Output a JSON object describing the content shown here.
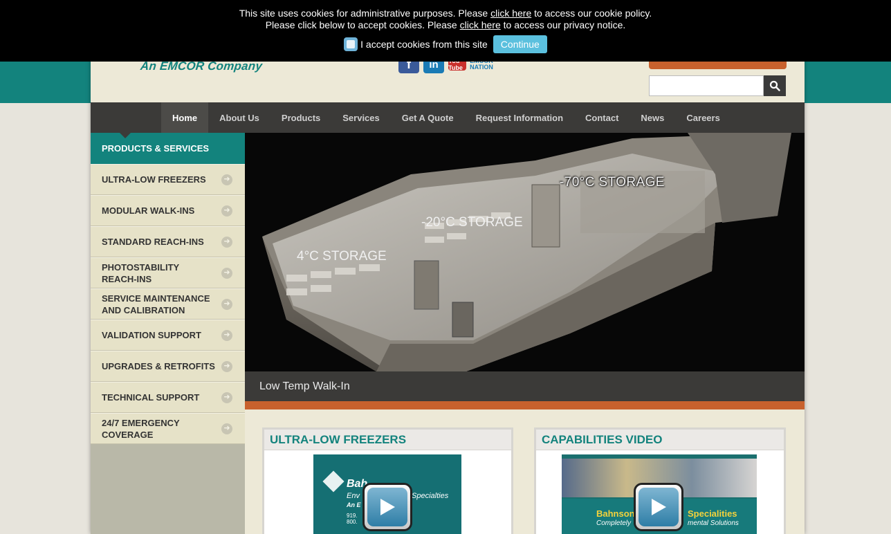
{
  "cookie": {
    "line1_prefix": "This site uses cookies for administrative purposes. Please ",
    "line1_link": "click here",
    "line1_suffix": " to access our cookie policy.",
    "line2_prefix": "Please click below to accept cookies. Please ",
    "line2_link": "click here",
    "line2_suffix": " to access our privacy notice.",
    "accept_label": "I accept cookies from this site",
    "continue_label": "Continue"
  },
  "header": {
    "tagline": "An EMCOR Company",
    "social": [
      "facebook-icon",
      "linkedin-icon",
      "youtube-icon",
      "emcor-nation-icon"
    ],
    "social_text": {
      "fb": "f",
      "li": "in",
      "yt": "You Tube",
      "ot1": "EMCOR",
      "ot2": "NATION"
    },
    "search_placeholder": ""
  },
  "nav": {
    "items": [
      "Home",
      "About Us",
      "Products",
      "Services",
      "Get A Quote",
      "Request Information",
      "Contact",
      "News",
      "Careers"
    ],
    "active": "Home"
  },
  "sidebar": {
    "heading": "PRODUCTS & SERVICES",
    "items": [
      "ULTRA-LOW FREEZERS",
      "MODULAR WALK-INS",
      "STANDARD REACH-INS",
      "PHOTOSTABILITY REACH-INS",
      "SERVICE MAINTENANCE AND CALIBRATION",
      "VALIDATION SUPPORT",
      "UPGRADES & RETROFITS",
      "TECHNICAL SUPPORT",
      "24/7 EMERGENCY COVERAGE"
    ]
  },
  "hero": {
    "labels": [
      "-70°C STORAGE",
      "-20°C STORAGE",
      "4°C STORAGE"
    ],
    "caption": "Low Temp Walk-In"
  },
  "panels": {
    "left_title": "ULTRA-LOW FREEZERS",
    "right_title": "CAPABILITIES VIDEO",
    "left_thumb_text": {
      "brand": "Bah",
      "line2": "Env",
      "line2b": "Specialties",
      "line3": "An E",
      "phone1": "919.",
      "phone2": "800."
    },
    "right_thumb_text": {
      "left": "Bahnson",
      "right": "Specialities",
      "sub_left": "Completely",
      "sub_right": "mental Solutions"
    }
  },
  "colors": {
    "teal": "#13837d",
    "orange": "#c8612d",
    "nav_bg": "#3b3a38",
    "cream": "#ede9d7"
  }
}
